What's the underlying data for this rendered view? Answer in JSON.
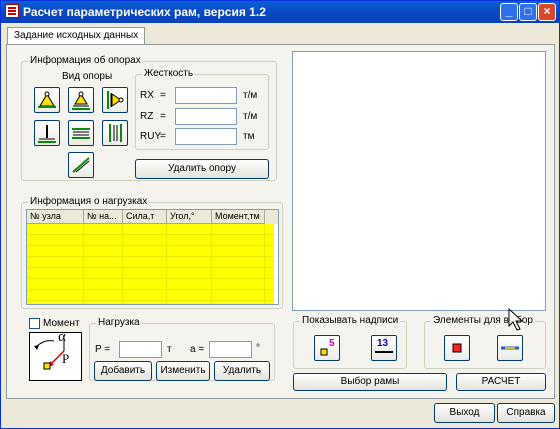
{
  "window": {
    "title": "Расчет параметрических рам, версия 1.2",
    "minimize": "_",
    "maximize": "□",
    "close": "×"
  },
  "tabs": [
    "Задание исходных данных"
  ],
  "supports": {
    "title": "Информация об опорах",
    "type_label": "Вид опоры",
    "stiffness_label": "Жесткость",
    "rows": [
      {
        "name": "RX",
        "eq": "=",
        "unit": "т/м",
        "value": ""
      },
      {
        "name": "RZ",
        "eq": "=",
        "unit": "т/м",
        "value": ""
      },
      {
        "name": "RUY",
        "eq": "=",
        "unit": "тм",
        "value": ""
      }
    ],
    "delete_button": "Удалить опору"
  },
  "loads": {
    "title": "Информация о нагрузках",
    "columns": [
      "№ узла",
      "№ на...",
      "Сила,т",
      "Угол,°",
      "Момент,тм"
    ]
  },
  "moment_checkbox": {
    "label": "Момент",
    "checked": false
  },
  "load_form": {
    "title": "Нагрузка",
    "p_label": "P =",
    "p_unit": "т",
    "a_label": "a =",
    "a_unit": "°",
    "p_value": "",
    "a_value": "",
    "diagram_alpha": "α",
    "diagram_p": "P",
    "buttons": [
      "Добавить",
      "Изменить",
      "Удалить"
    ]
  },
  "labels_group": {
    "title": "Показывать надписи",
    "btn1_num": "5",
    "btn2_num": "13"
  },
  "elements_group": {
    "title": "Элементы для выбор"
  },
  "frame_button": "Выбор рамы",
  "calc_button": "РАСЧЕТ",
  "footer": {
    "exit": "Выход",
    "help": "Справка"
  },
  "colors": {
    "grid_fill": "#FFFF00",
    "titlebar": "#0B4BC7"
  }
}
